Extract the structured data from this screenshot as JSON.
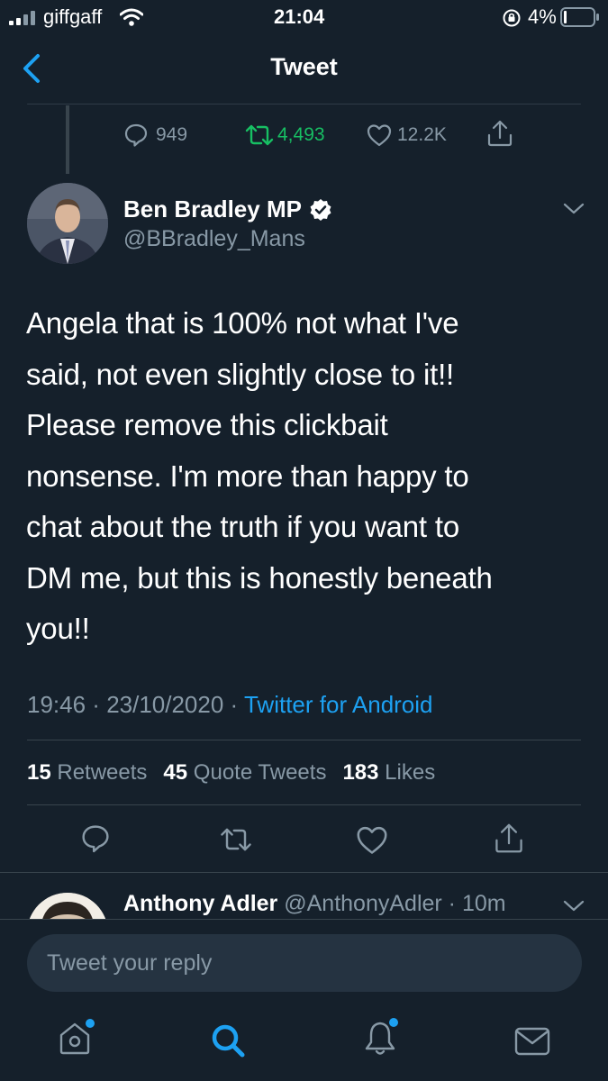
{
  "status_bar": {
    "carrier": "giffgaff",
    "time": "21:04",
    "battery": "4%"
  },
  "header": {
    "title": "Tweet"
  },
  "parent_actions": {
    "replies": "949",
    "retweets": "4,493",
    "likes": "12.2K"
  },
  "tweet": {
    "author_name": "Ben Bradley MP",
    "handle": "@BBradley_Mans",
    "text_lines": [
      "Angela that is 100% not what I've",
      "said, not even slightly close to it!!",
      "Please remove this clickbait",
      "nonsense. I'm more than happy to",
      "chat about the truth if you want to",
      "DM me, but this is honestly beneath",
      "you!!"
    ],
    "time": "19:46",
    "date": "23/10/2020",
    "source": "Twitter for Android",
    "stats": {
      "retweets_count": "15",
      "retweets_label": "Retweets",
      "quotes_count": "45",
      "quotes_label": "Quote Tweets",
      "likes_count": "183",
      "likes_label": "Likes"
    }
  },
  "reply_preview": {
    "name": "Anthony Adler",
    "handle": "@AnthonyAdler",
    "age": "10m"
  },
  "composer": {
    "placeholder": "Tweet your reply"
  },
  "colors": {
    "background": "#15202b",
    "accent": "#1da1f2",
    "muted": "#8899a6",
    "retweet_green": "#17bf63"
  }
}
